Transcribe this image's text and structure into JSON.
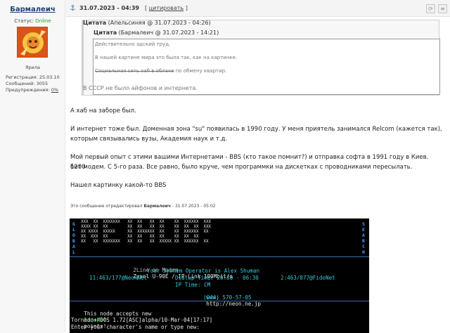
{
  "user": {
    "name": "Бармалеич",
    "status_label": "Статус:",
    "status_value": "Online",
    "rank": "Ярила",
    "reg_label": "Регистрация:",
    "reg_value": "25.03.10",
    "posts_label": "Сообщений:",
    "posts_value": "3055",
    "warn_label": "Предупреждения:",
    "warn_value": "0%"
  },
  "post": {
    "date": "31.07.2023 - 04:39",
    "cite_link": "цитировать",
    "cite_open": "[",
    "cite_close": "]"
  },
  "quote_outer": {
    "label": "Цитата",
    "meta": "(Апельсиняя @ 31.07.2023 - 04:26)",
    "text": "В СССР не было айфонов и интернета."
  },
  "quote_inner": {
    "label": "Цитата",
    "meta": "(Бармалеич @ 31.07.2023 - 14:21)",
    "line1": "Действительно адский труд.",
    "line2": "В нашей картине мира это была так, как на картинке.",
    "line3_strike": "Социальная сеть хаб в облаке",
    "line3_rest": "по обмену квартир."
  },
  "body": {
    "p1": "А хаб на заборе был.",
    "p2a": "И интернет тоже был. Доменная зона \"su\" появилась в 1990 году. У меня приятель занимался Relcom (кажется так),",
    "p2b": "которым связывались вузы, Академия наук и т.д.",
    "p3a": "Мой первый опыт с этими вашими Интернетами - BBS (кто такое помнит?) и отправка софта в 1991 году в Киев. 1200",
    "p3b": "бит модем. С 5-го раза. Все равно, было круче, чем программки на дискетках с проводниками пересылать.",
    "p4": "Нашел картинку какой-то BBS"
  },
  "edit": {
    "prefix": "Это сообщение отредактировал",
    "author": "Бармалеич",
    "suffix": "- 31.07.2023 - 05:02"
  },
  "terminal": {
    "left_vertical": "GLOBAL",
    "right_vertical": "SEARCH",
    "banner_rows": [
      "XXX  XX  XXXXXXX   XX  XX   XX  XX    XX  XXXXXX  XXX",
      "XXXX XX  XX        XX  XX   XX  XX    XX  XX  XX  XXX",
      "XX XXXX  XXXXX     XX  XXXXXXX  XX    XX  XXXXXX  XX ",
      "XX  XXX  XX        XX  XX   XX  XX    XX  XX  XX     ",
      "XX   XX  XXXXXXX   XX  XX   XX  XXXXX XX  XXXXXX  XX "
    ],
    "line1_a": "2Line on Modem",
    "line1_b": "Zyxel U-90E / IP-Link 100Mbit/s",
    "line2": "Your System Operator is Alex Shuman",
    "line3_left": "11:463/177@NeonNet",
    "line3_mid": "Dialup Time: 20:30 - 06:30",
    "line3_right": "2:463/877@FidoNet",
    "line4": "IP Time: CM",
    "line5_label": "www:",
    "line5_url": "http://neon.ne.jp",
    "line6": "(044) 570-57-05",
    "line7_a": "This node accepts new",
    "line7_b": "FidoNet",
    "line7_c": "points!",
    "line8": "Tornado+/DOS 1.72[ASC]alpha/10-Mar-04[17:17]",
    "line9": "Enter your character's name or type new:"
  },
  "colors": {
    "username": "#1f3f73",
    "online": "#2c9a2c",
    "terminal_bg": "#000000",
    "terminal_cyan": "#36c9d8",
    "terminal_green": "#3cd04a",
    "terminal_blue": "#4aa3ff"
  }
}
